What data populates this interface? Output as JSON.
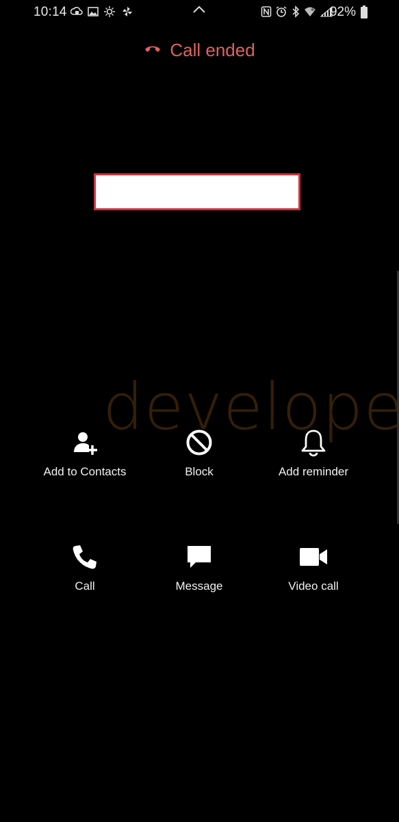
{
  "status_bar": {
    "time": "10:14",
    "battery_percent": "92%",
    "left_icons": [
      "cloud-sync-icon",
      "gallery-icon",
      "weather-icon",
      "pinwheel-icon"
    ],
    "right_icons": [
      "nfc-icon",
      "alarm-icon",
      "bluetooth-icon",
      "wifi-icon",
      "signal-icon"
    ]
  },
  "header": {
    "status": "Call ended",
    "status_color": "#e0625e"
  },
  "caller": {
    "name_redacted": true,
    "highlight_color": "#d0333a"
  },
  "watermark": "developers",
  "actions_row1": [
    {
      "label": "Add to Contacts",
      "icon": "add-contact-icon"
    },
    {
      "label": "Block",
      "icon": "block-icon"
    },
    {
      "label": "Add reminder",
      "icon": "bell-icon"
    }
  ],
  "actions_row2": [
    {
      "label": "Call",
      "icon": "phone-icon"
    },
    {
      "label": "Message",
      "icon": "message-icon"
    },
    {
      "label": "Video call",
      "icon": "video-camera-icon"
    }
  ]
}
